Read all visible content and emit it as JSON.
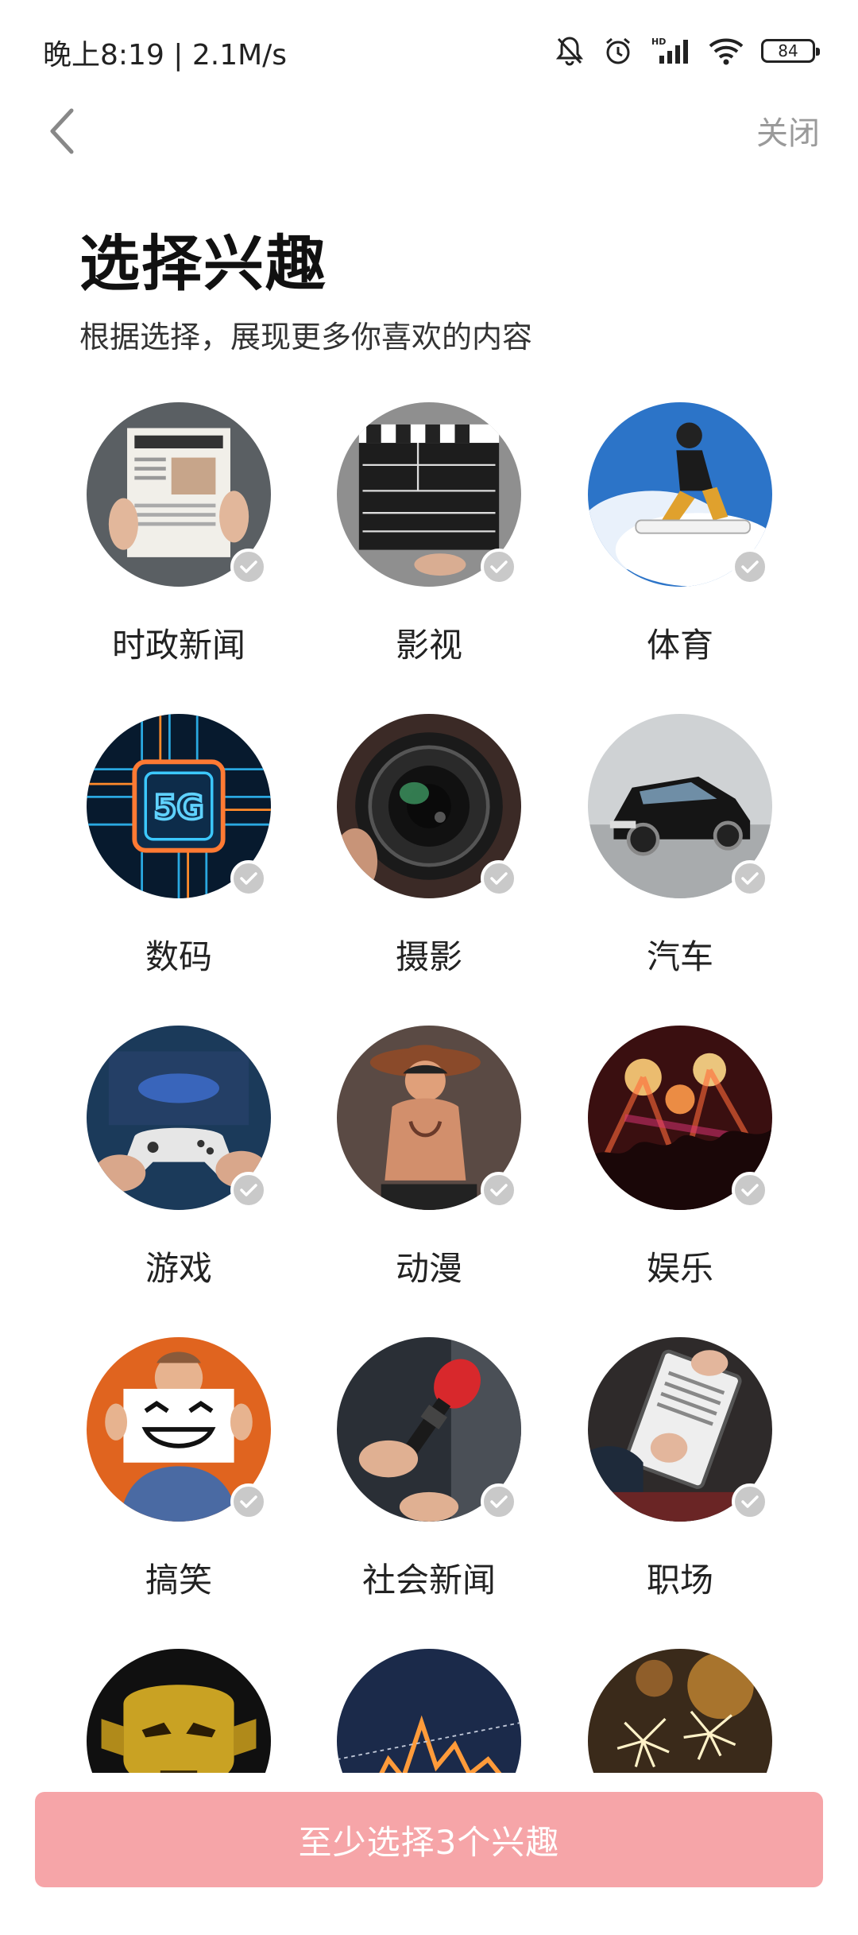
{
  "status_bar": {
    "time": "晚上8:19 | 2.1M/s",
    "battery": "84",
    "icons": [
      "mute-bell-icon",
      "alarm-icon",
      "hd-signal-icon",
      "wifi-icon",
      "battery-icon"
    ]
  },
  "nav": {
    "back_icon": "chevron-left-icon",
    "close_label": "关闭"
  },
  "header": {
    "title": "选择兴趣",
    "subtitle": "根据选择，展现更多你喜欢的内容"
  },
  "interests": [
    {
      "label": "时政新闻",
      "selected": false
    },
    {
      "label": "影视",
      "selected": false
    },
    {
      "label": "体育",
      "selected": false
    },
    {
      "label": "数码",
      "selected": false
    },
    {
      "label": "摄影",
      "selected": false
    },
    {
      "label": "汽车",
      "selected": false
    },
    {
      "label": "游戏",
      "selected": false
    },
    {
      "label": "动漫",
      "selected": false
    },
    {
      "label": "娱乐",
      "selected": false
    },
    {
      "label": "搞笑",
      "selected": false
    },
    {
      "label": "社会新闻",
      "selected": false
    },
    {
      "label": "职场",
      "selected": false
    },
    {
      "label": "",
      "selected": false
    },
    {
      "label": "",
      "selected": false
    },
    {
      "label": "",
      "selected": false
    }
  ],
  "cta": {
    "label": "至少选择3个兴趣"
  },
  "colors": {
    "cta_bg": "#f6a5a8",
    "check_bg": "#c9c9c9",
    "close_text": "#9a9a9a"
  }
}
